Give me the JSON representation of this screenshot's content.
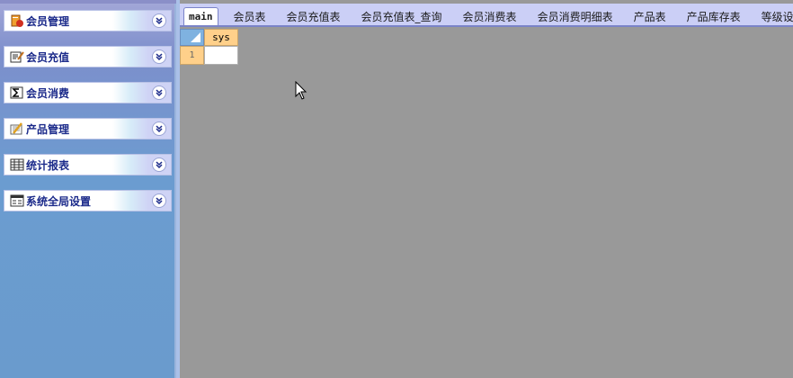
{
  "sidebar": {
    "groups": [
      {
        "label": "会员管理",
        "icon": "member-manage-icon"
      },
      {
        "label": "会员充值",
        "icon": "edit-note-icon"
      },
      {
        "label": "会员消费",
        "icon": "sigma-icon"
      },
      {
        "label": "产品管理",
        "icon": "pencil-ruler-icon"
      },
      {
        "label": "统计报表",
        "icon": "table-grid-icon"
      },
      {
        "label": "系统全局设置",
        "icon": "form-window-icon"
      }
    ]
  },
  "tabs": [
    {
      "label": "main",
      "active": true
    },
    {
      "label": "会员表"
    },
    {
      "label": "会员充值表"
    },
    {
      "label": "会员充值表_查询"
    },
    {
      "label": "会员消费表"
    },
    {
      "label": "会员消费明细表"
    },
    {
      "label": "产品表"
    },
    {
      "label": "产品库存表"
    },
    {
      "label": "等级设"
    }
  ],
  "grid": {
    "columns": [
      "sys"
    ],
    "rows": [
      {
        "row_number": "1",
        "values": [
          ""
        ]
      }
    ]
  },
  "colors": {
    "tab_bar": "#cbcff6",
    "workspace": "#999999",
    "sidebar": "#6a9bcd",
    "nav_label": "#1b2a8a",
    "grid_header": "#ffd08a"
  }
}
